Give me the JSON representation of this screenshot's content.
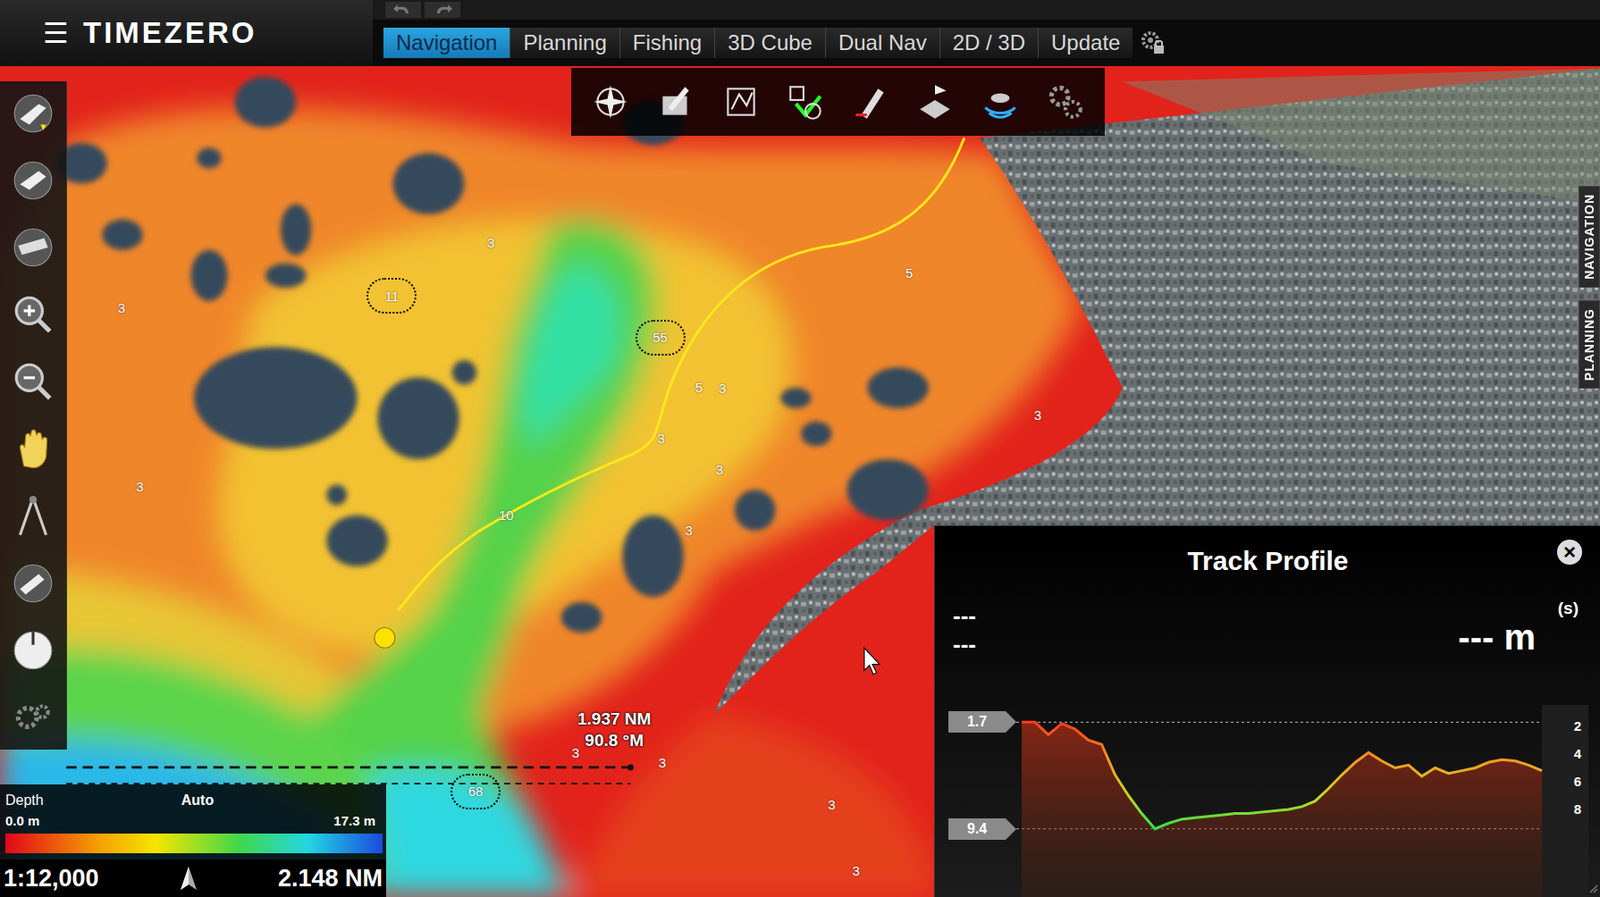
{
  "app": {
    "menu_icon": "☰",
    "title": "TIMEZERO"
  },
  "tabs": [
    {
      "label": "Navigation",
      "selected": true
    },
    {
      "label": "Planning",
      "selected": false
    },
    {
      "label": "Fishing",
      "selected": false
    },
    {
      "label": "3D Cube",
      "selected": false
    },
    {
      "label": "Dual Nav",
      "selected": false
    },
    {
      "label": "2D / 3D",
      "selected": false
    },
    {
      "label": "Update",
      "selected": false
    }
  ],
  "side_tabs": [
    {
      "label": "NAVIGATION"
    },
    {
      "label": "PLANNING"
    }
  ],
  "map": {
    "soundings": [
      {
        "value": "3",
        "circled": false
      },
      {
        "value": "11",
        "circled": true
      },
      {
        "value": "3",
        "circled": false
      },
      {
        "value": "55",
        "circled": true
      },
      {
        "value": "5",
        "circled": false
      },
      {
        "value": "5",
        "circled": false
      },
      {
        "value": "3",
        "circled": false
      },
      {
        "value": "3",
        "circled": false
      },
      {
        "value": "3",
        "circled": false
      },
      {
        "value": "3",
        "circled": false
      },
      {
        "value": "3",
        "circled": false
      },
      {
        "value": "10",
        "circled": false
      },
      {
        "value": "3",
        "circled": false
      },
      {
        "value": "3",
        "circled": false
      },
      {
        "value": "3",
        "circled": false
      },
      {
        "value": "68",
        "circled": true
      },
      {
        "value": "3",
        "circled": false
      },
      {
        "value": "3",
        "circled": false
      }
    ],
    "measure": {
      "distance": "1.937 NM",
      "bearing": "90.8 °M"
    }
  },
  "depth_legend": {
    "title": "Depth",
    "mode": "Auto",
    "min": "0.0 m",
    "max": "17.3 m"
  },
  "status": {
    "scale": "1:12,000",
    "range": "2.148 NM"
  },
  "track_profile": {
    "title": "Track Profile",
    "close": "×",
    "readouts": [
      "---",
      "---"
    ],
    "depth_reading": "--- m",
    "unit_toggle": "(s)",
    "min_marker": "1.7",
    "max_marker": "9.4",
    "axis_ticks": [
      "2",
      "4",
      "6",
      "8"
    ],
    "depths": [
      1.7,
      1.7,
      2.6,
      1.8,
      2.2,
      3.0,
      3.3,
      5.5,
      7.0,
      8.3,
      9.4,
      9.0,
      8.7,
      8.6,
      8.5,
      8.4,
      8.3,
      8.3,
      8.2,
      8.1,
      8.0,
      7.8,
      7.4,
      6.5,
      5.5,
      4.6,
      3.9,
      4.5,
      5.0,
      4.8,
      5.6,
      5.0,
      5.4,
      5.2,
      5.0,
      4.6,
      4.4,
      4.5,
      4.8,
      5.2
    ]
  }
}
